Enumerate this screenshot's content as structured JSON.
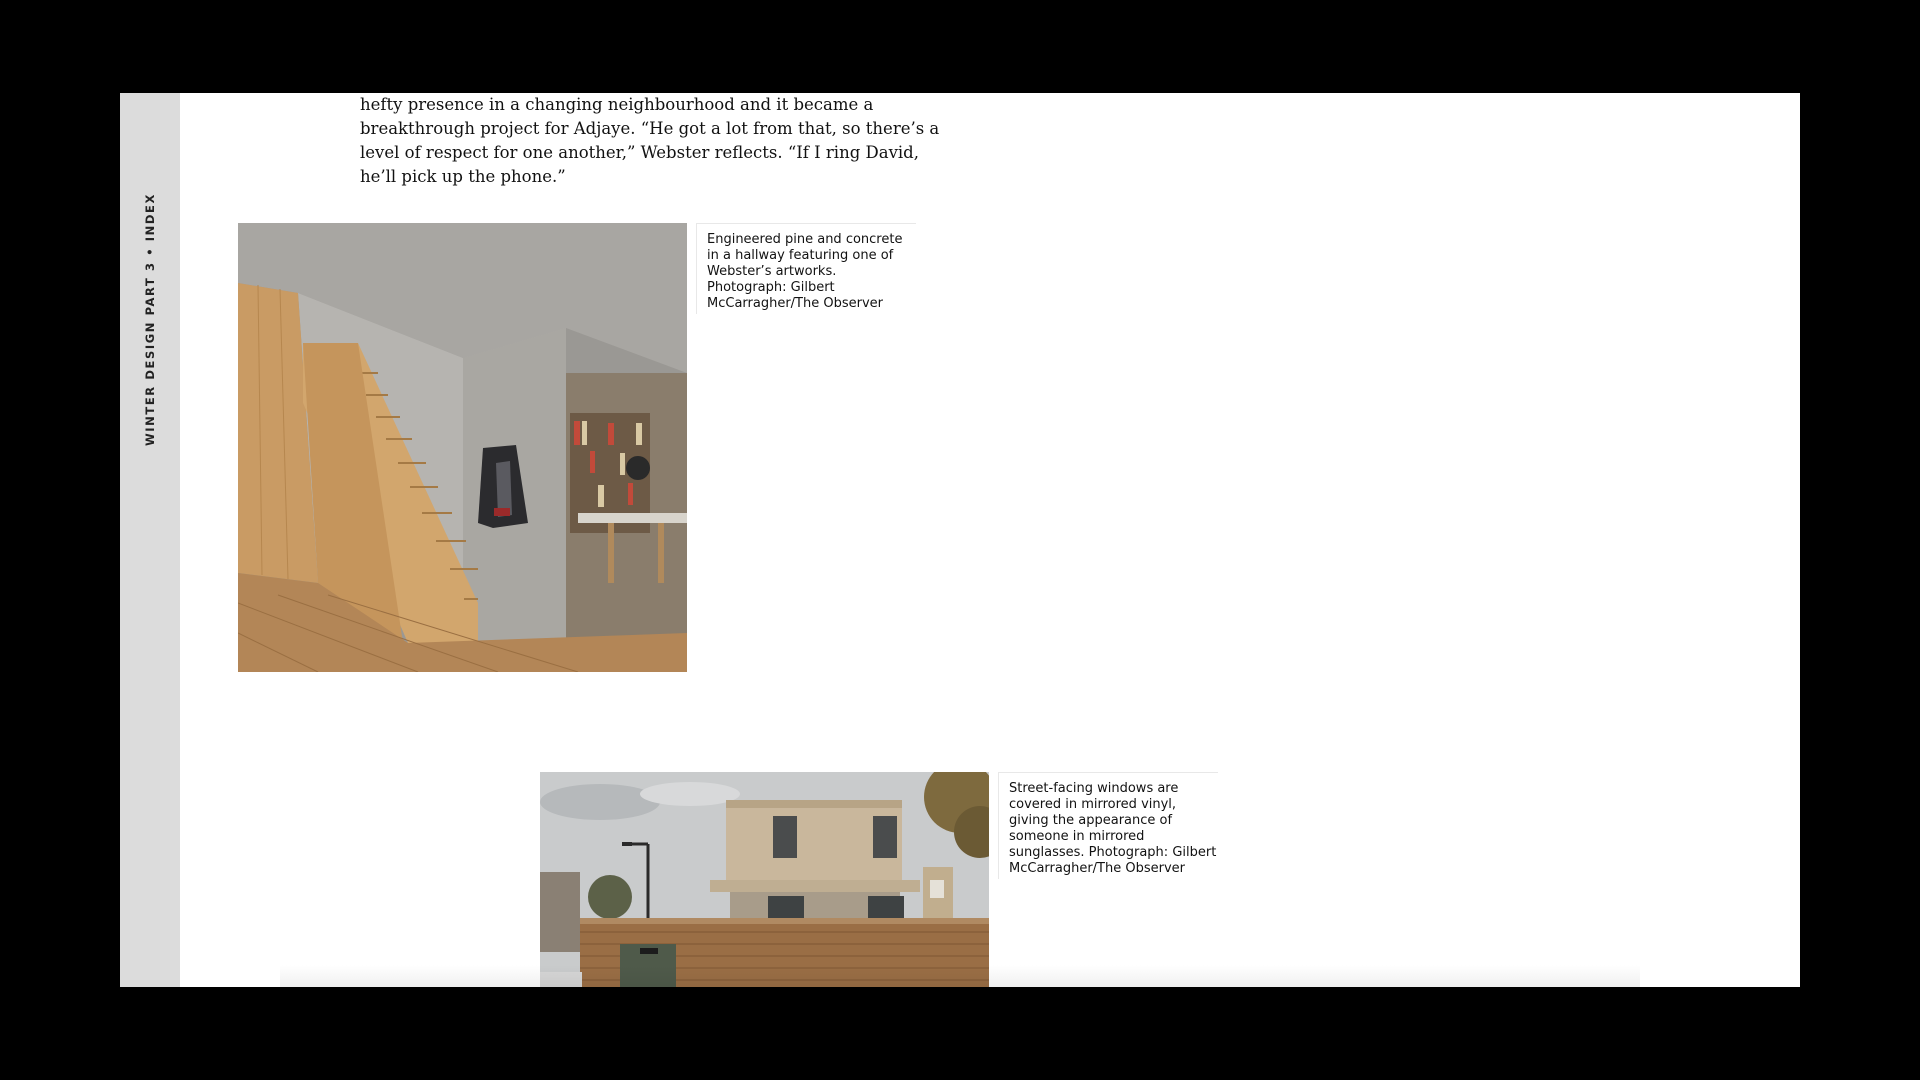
{
  "sidebar": {
    "label": "WINTER DESIGN PART 3 • INDEX"
  },
  "article": {
    "paragraph": "hefty presence in a changing neighbourhood and it became a breakthrough project for Adjaye. “He got a lot from that, so there’s a level of respect for one another,” Webster reflects. “If I ring David, he’ll pick up the phone.”"
  },
  "figures": [
    {
      "image": "interior-staircase-photo",
      "caption": "Engineered pine and concrete in a hallway featuring one of Webster’s artworks. Photograph: Gilbert McCarragher/The Observer"
    },
    {
      "image": "house-exterior-photo",
      "caption": "Street-facing windows are covered in mirrored vinyl, giving the appearance of someone in mirrored sunglasses. Photograph: Gilbert McCarragher/The Observer"
    }
  ],
  "colors": {
    "page": "#ffffff",
    "rail": "#dcdcdc",
    "frame": "#000000",
    "text": "#121212"
  }
}
